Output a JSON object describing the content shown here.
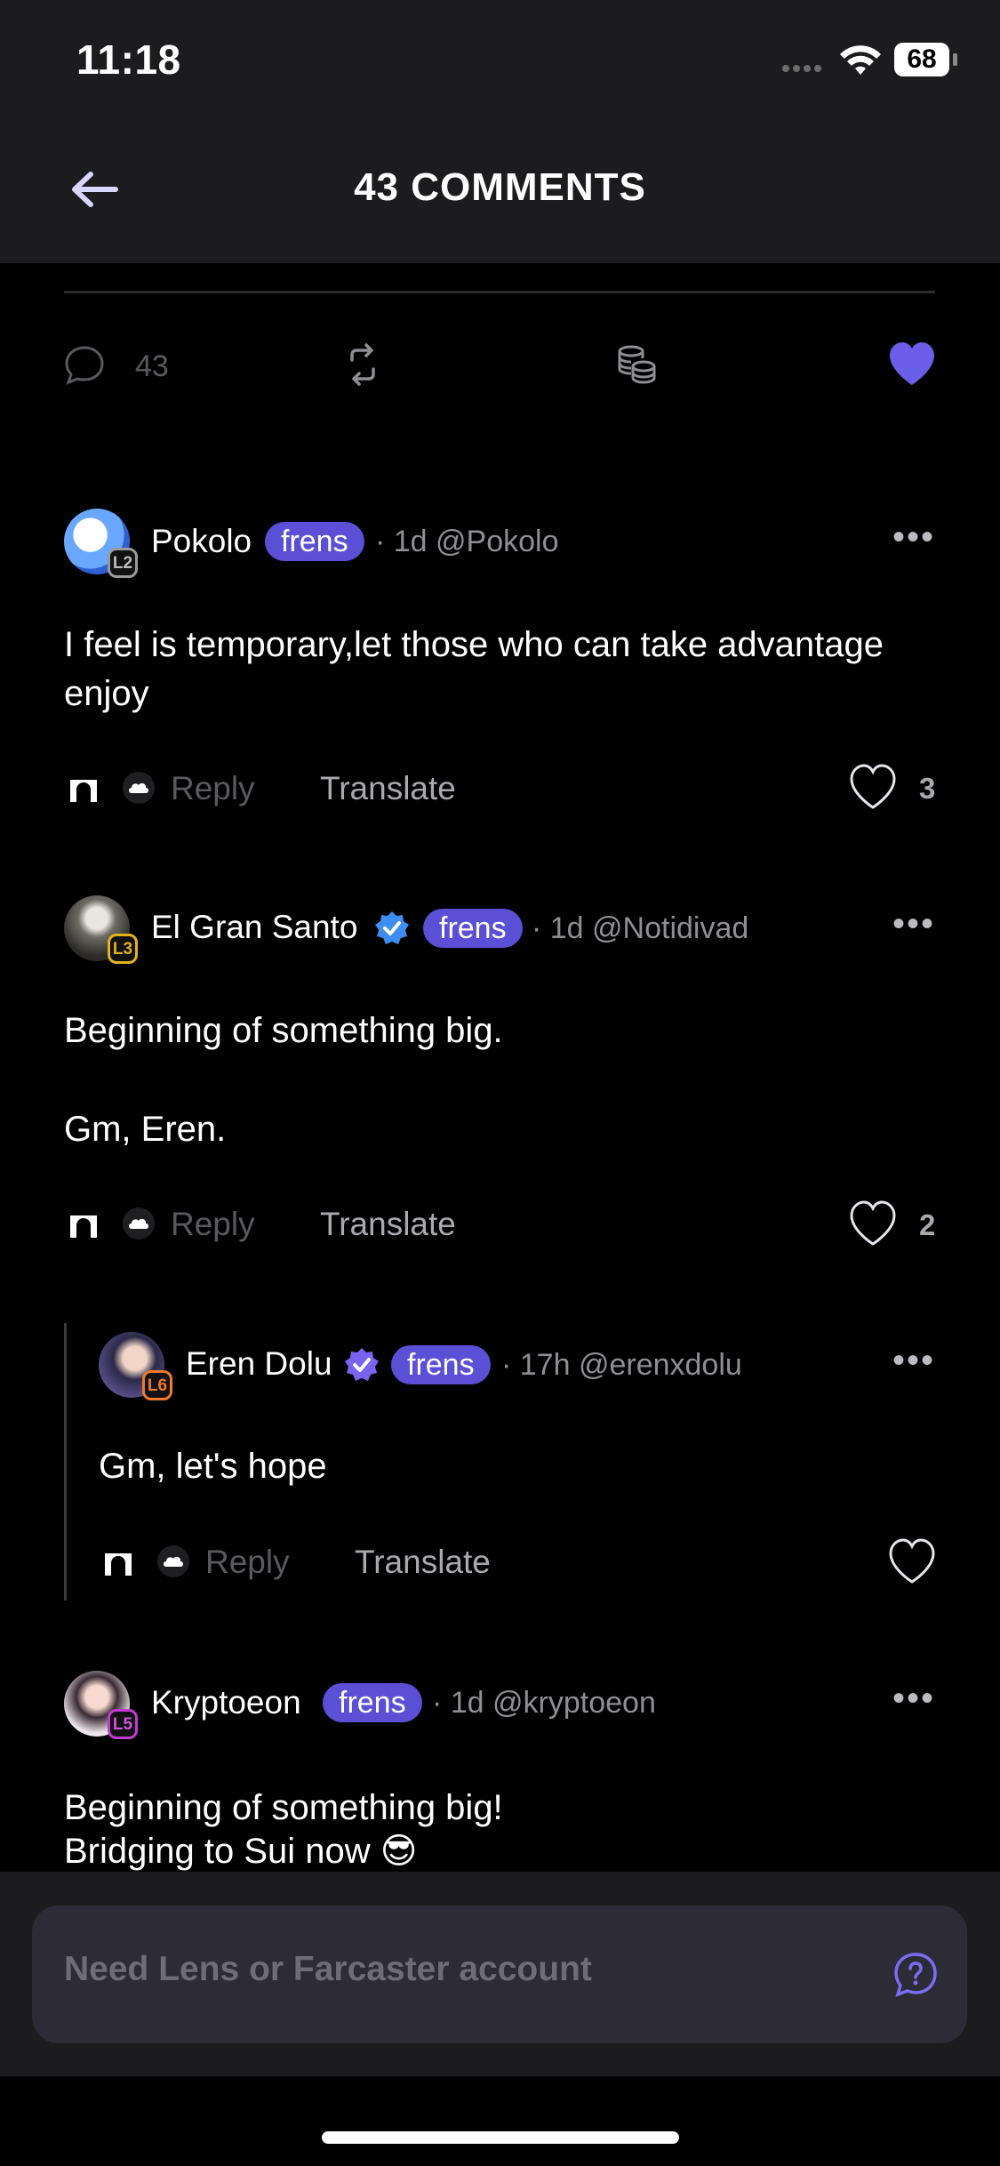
{
  "status": {
    "time": "11:18",
    "battery": "68"
  },
  "header": {
    "title": "43 COMMENTS"
  },
  "post_actions": {
    "comment_count": "43"
  },
  "comments": [
    {
      "name": "Pokolo",
      "badge": "frens",
      "meta": "· 1d @Pokolo",
      "level": "L2",
      "text": "I feel is temporary,let those who can take advantage enjoy",
      "reply": "Reply",
      "translate": "Translate",
      "likes": "3"
    },
    {
      "name": "El Gran Santo",
      "badge": "frens",
      "meta": "· 1d @Notidivad",
      "level": "L3",
      "text_lines": [
        "Beginning of something big.",
        "Gm, Eren."
      ],
      "reply": "Reply",
      "translate": "Translate",
      "likes": "2"
    },
    {
      "name": "Eren Dolu",
      "badge": "frens",
      "meta": "· 17h @erenxdolu",
      "level": "L6",
      "text": "Gm, let's hope",
      "reply": "Reply",
      "translate": "Translate"
    },
    {
      "name": "Kryptoeon",
      "badge": "frens",
      "meta": "· 1d @kryptoeon",
      "level": "L5",
      "text_lines": [
        "Beginning of something big!",
        "Bridging to Sui now 😎"
      ]
    }
  ],
  "composer": {
    "placeholder": "Need Lens or Farcaster account"
  },
  "colors": {
    "accent": "#5b4fd6",
    "background": "#000000",
    "header": "#1c1c1e"
  }
}
